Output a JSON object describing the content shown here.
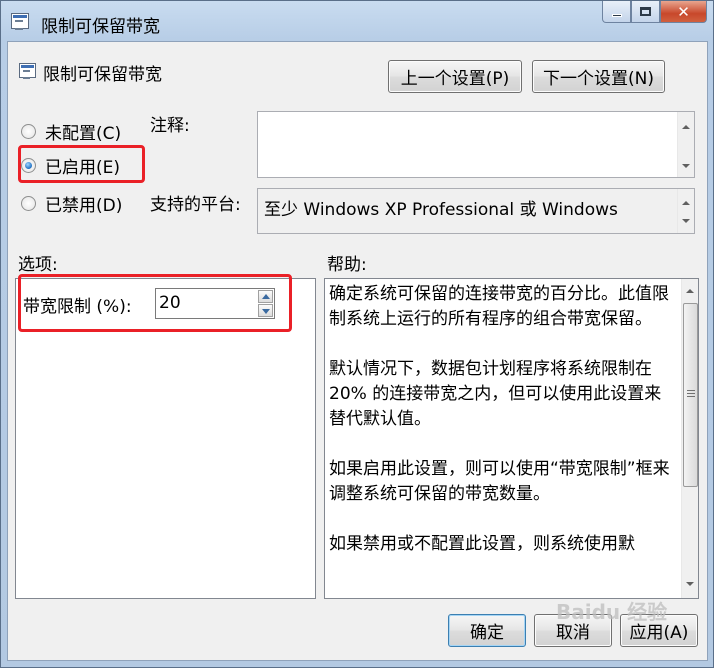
{
  "window": {
    "title": "限制可保留带宽",
    "controls": {
      "minimize": "—",
      "maximize": "□",
      "close": "✕"
    }
  },
  "header": {
    "policy_name": "限制可保留带宽",
    "prev_button": "上一个设置(P)",
    "next_button": "下一个设置(N)"
  },
  "state": {
    "options": [
      {
        "label": "未配置(C)",
        "selected": false
      },
      {
        "label": "已启用(E)",
        "selected": true
      },
      {
        "label": "已禁用(D)",
        "selected": false
      }
    ]
  },
  "comment": {
    "label": "注释:",
    "value": ""
  },
  "platform": {
    "label": "支持的平台:",
    "value": "至少 Windows XP Professional 或 Windows"
  },
  "options_section": {
    "label": "选项:",
    "bandwidth_label": "带宽限制 (%):",
    "bandwidth_value": "20"
  },
  "help_section": {
    "label": "帮助:",
    "text": "确定系统可保留的连接带宽的百分比。此值限制系统上运行的所有程序的组合带宽保留。\n\n默认情况下，数据包计划程序将系统限制在 20% 的连接带宽之内，但可以使用此设置来替代默认值。\n\n如果启用此设置，则可以使用“带宽限制”框来调整系统可保留的带宽数量。\n\n如果禁用或不配置此设置，则系统使用默"
  },
  "footer": {
    "ok": "确定",
    "cancel": "取消",
    "apply": "应用(A)"
  },
  "watermark": "Baidu 经验",
  "colors": {
    "highlight": "#ea2027",
    "title_bg": "#c9dcf0",
    "close": "#c8482b"
  }
}
